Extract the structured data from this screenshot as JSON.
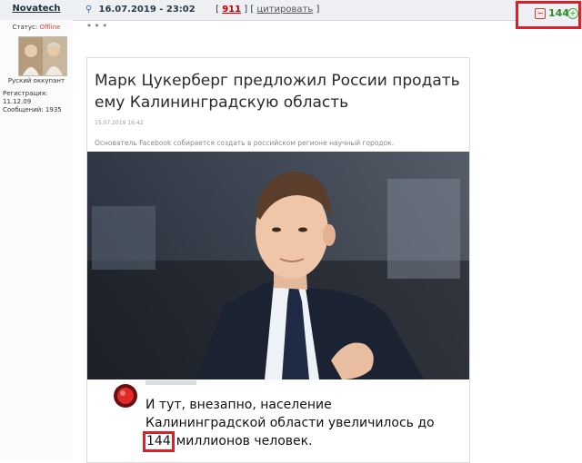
{
  "post": {
    "username": "Novatech",
    "date_time": "16.07.2019 - 23:02",
    "post_number": "911",
    "quote_link": "цитировать",
    "rating": "144",
    "stars": "* * *"
  },
  "user": {
    "status_label": "Статус:",
    "status_value": "Offline",
    "title": "Руский оккупант",
    "registration": "Регистрация: 11.12.09",
    "messages": "Сообщений: 1935"
  },
  "article": {
    "headline": "Марк Цукерберг предложил России продать ему Калининградскую область",
    "date": "15.07.2019 16:42",
    "lead": "Основатель Facebook собирается создать в российском регионе научный городок."
  },
  "caption": {
    "line1": "И тут, внезапно, население",
    "line2": "Калининградской области увеличилось до",
    "number": "144",
    "line3_rest": "миллионов человек."
  },
  "colors": {
    "highlight_border": "#dd1f2a",
    "rating_green": "#2e8b2e",
    "offline": "#cc4433",
    "post_number": "#c00000"
  },
  "icons": [
    "pin-icon",
    "rate-down-icon",
    "rate-up-icon",
    "record-icon",
    "avatar"
  ]
}
